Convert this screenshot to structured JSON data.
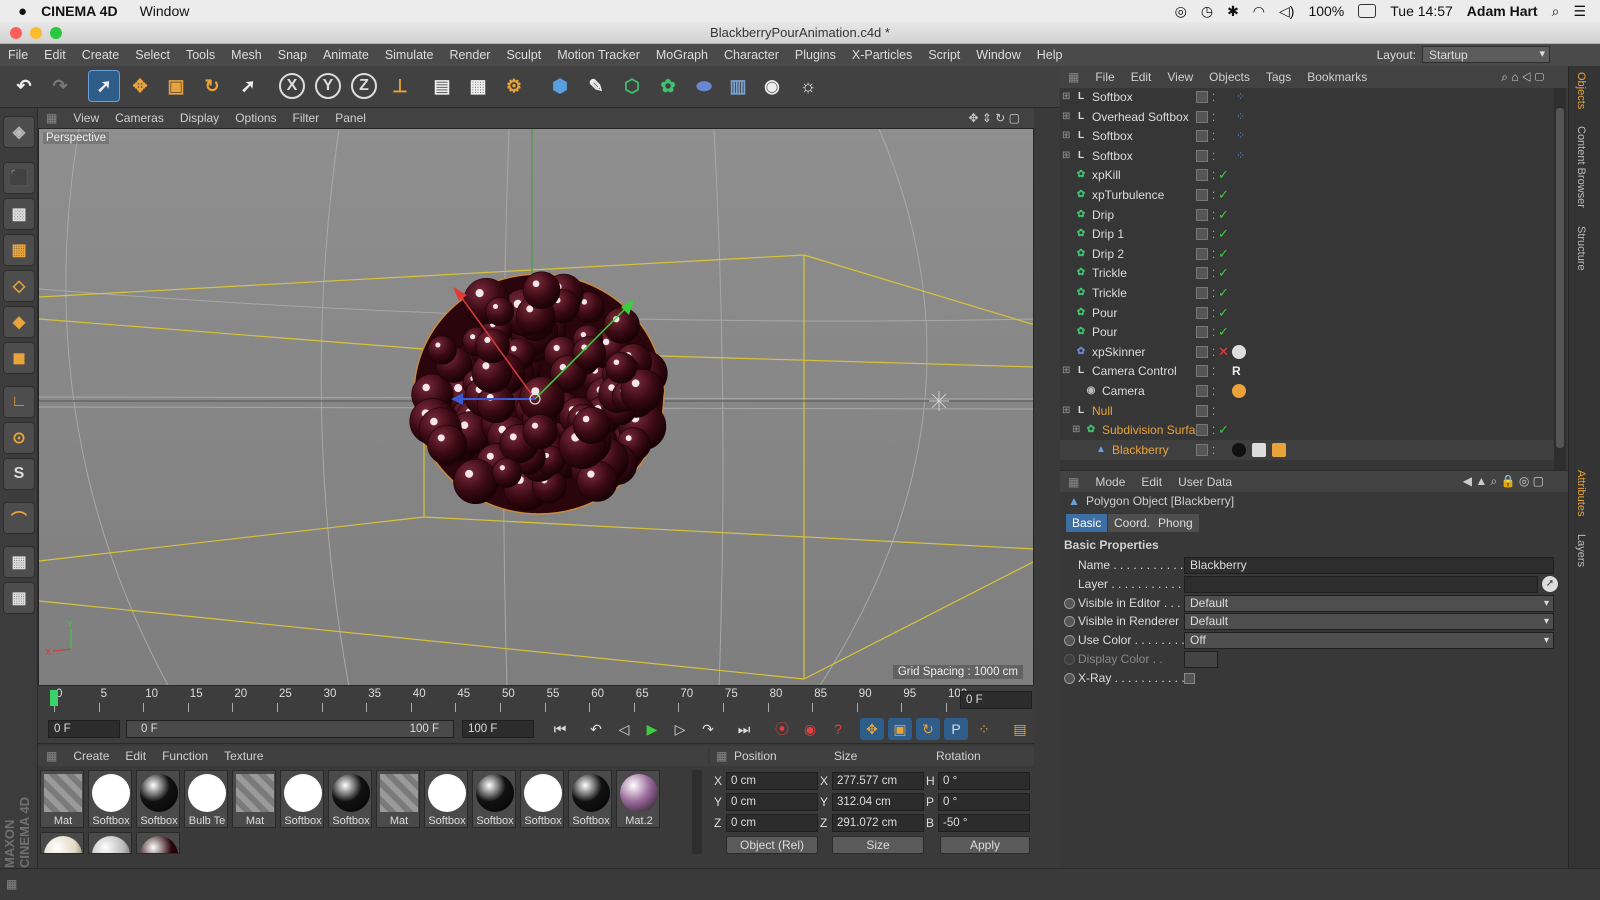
{
  "macbar": {
    "app_name": "CINEMA 4D",
    "menu": "Window",
    "battery": "100%",
    "clock": "Tue 14:57",
    "user": "Adam Hart"
  },
  "window": {
    "title": "BlackberryPourAnimation.c4d *"
  },
  "app_menu": [
    "File",
    "Edit",
    "Create",
    "Select",
    "Tools",
    "Mesh",
    "Snap",
    "Animate",
    "Simulate",
    "Render",
    "Sculpt",
    "Motion Tracker",
    "MoGraph",
    "Character",
    "Plugins",
    "X-Particles",
    "Script",
    "Window",
    "Help"
  ],
  "layout": {
    "label": "Layout:",
    "value": "Startup"
  },
  "toolbar": {
    "axes": [
      "X",
      "Y",
      "Z"
    ]
  },
  "viewport": {
    "menu": [
      "View",
      "Cameras",
      "Display",
      "Options",
      "Filter",
      "Panel"
    ],
    "label": "Perspective",
    "grid_spacing": "Grid Spacing : 1000 cm"
  },
  "timeline": {
    "ticks": [
      "0",
      "5",
      "10",
      "15",
      "20",
      "25",
      "30",
      "35",
      "40",
      "45",
      "50",
      "55",
      "60",
      "65",
      "70",
      "75",
      "80",
      "85",
      "90",
      "95",
      "100"
    ],
    "current_frame_field": "0 F",
    "start_field": "0 F",
    "range_start": "0 F",
    "range_end": "100 F",
    "end_field": "100 F"
  },
  "materials": {
    "menu": [
      "Create",
      "Edit",
      "Function",
      "Texture"
    ],
    "items": [
      {
        "label": "Mat",
        "color": "#8a8a8a"
      },
      {
        "label": "Softbox",
        "color": "#ffffff"
      },
      {
        "label": "Softbox",
        "color": "#111111"
      },
      {
        "label": "Bulb Te",
        "color": "#ffffff"
      },
      {
        "label": "Mat",
        "color": "#8a8a8a"
      },
      {
        "label": "Softbox",
        "color": "#ffffff"
      },
      {
        "label": "Softbox",
        "color": "#111111"
      },
      {
        "label": "Mat",
        "color": "#8a8a8a"
      },
      {
        "label": "Softbox",
        "color": "#ffffff"
      },
      {
        "label": "Softbox",
        "color": "#111111"
      },
      {
        "label": "Softbox",
        "color": "#ffffff"
      },
      {
        "label": "Softbox",
        "color": "#111111"
      },
      {
        "label": "Mat.2",
        "color": "#9a6a9a"
      }
    ]
  },
  "coords": {
    "headers": [
      "Position",
      "Size",
      "Rotation"
    ],
    "rows": [
      {
        "pl": "X",
        "pv": "0 cm",
        "sl": "X",
        "sv": "277.577 cm",
        "rl": "H",
        "rv": "0 °"
      },
      {
        "pl": "Y",
        "pv": "0 cm",
        "sl": "Y",
        "sv": "312.04 cm",
        "rl": "P",
        "rv": "0 °"
      },
      {
        "pl": "Z",
        "pv": "0 cm",
        "sl": "Z",
        "sv": "291.072 cm",
        "rl": "B",
        "rv": "-50 °"
      }
    ],
    "mode": "Object (Rel)",
    "size_mode": "Size",
    "apply": "Apply"
  },
  "objects": {
    "menu": [
      "File",
      "Edit",
      "View",
      "Objects",
      "Tags",
      "Bookmarks"
    ],
    "rows": [
      {
        "name": "Softbox",
        "indent": 0,
        "icon": "L0",
        "color": "#dcdcdc"
      },
      {
        "name": "Overhead Softbox",
        "indent": 0,
        "icon": "L0",
        "color": "#dcdcdc"
      },
      {
        "name": "Softbox",
        "indent": 0,
        "icon": "L0",
        "color": "#dcdcdc"
      },
      {
        "name": "Softbox",
        "indent": 0,
        "icon": "L0",
        "color": "#dcdcdc"
      },
      {
        "name": "xpKill",
        "indent": 0,
        "icon": "K",
        "color": "#dcdcdc"
      },
      {
        "name": "xpTurbulence",
        "indent": 0,
        "icon": "T",
        "color": "#dcdcdc"
      },
      {
        "name": "Drip",
        "indent": 0,
        "icon": "E",
        "color": "#dcdcdc"
      },
      {
        "name": "Drip 1",
        "indent": 0,
        "icon": "E",
        "color": "#dcdcdc"
      },
      {
        "name": "Drip 2",
        "indent": 0,
        "icon": "E",
        "color": "#dcdcdc"
      },
      {
        "name": "Trickle",
        "indent": 0,
        "icon": "E",
        "color": "#dcdcdc"
      },
      {
        "name": "Trickle",
        "indent": 0,
        "icon": "E",
        "color": "#dcdcdc"
      },
      {
        "name": "Pour",
        "indent": 0,
        "icon": "E",
        "color": "#dcdcdc"
      },
      {
        "name": "Pour",
        "indent": 0,
        "icon": "E",
        "color": "#dcdcdc"
      },
      {
        "name": "xpSkinner",
        "indent": 0,
        "icon": "S",
        "color": "#dcdcdc"
      },
      {
        "name": "Camera Control",
        "indent": 0,
        "icon": "L0",
        "color": "#dcdcdc"
      },
      {
        "name": "Camera",
        "indent": 1,
        "icon": "C",
        "color": "#dcdcdc"
      },
      {
        "name": "Null",
        "indent": 0,
        "icon": "L0",
        "color": "#e8a33a"
      },
      {
        "name": "Subdivision Surface",
        "indent": 1,
        "icon": "SD",
        "color": "#e8a33a"
      },
      {
        "name": "Blackberry",
        "indent": 2,
        "icon": "P",
        "color": "#e8a33a"
      }
    ]
  },
  "attributes": {
    "menu": [
      "Mode",
      "Edit",
      "User Data"
    ],
    "object_title": "Polygon Object [Blackberry]",
    "tabs": [
      "Basic",
      "Coord.",
      "Phong"
    ],
    "section": "Basic Properties",
    "fields": [
      {
        "label": "Name . . . . . . . . . . . .",
        "value": "Blackberry",
        "type": "text"
      },
      {
        "label": "Layer . . . . . . . . . . . .",
        "value": "",
        "type": "text"
      },
      {
        "label": "Visible in Editor . . .",
        "value": "Default",
        "type": "dd"
      },
      {
        "label": "Visible in Renderer",
        "value": "Default",
        "type": "dd"
      },
      {
        "label": "Use Color . . . . . . . .",
        "value": "Off",
        "type": "dd"
      },
      {
        "label": "Display Color . .",
        "value": "",
        "type": "swatch"
      },
      {
        "label": "X-Ray . . . . . . . . . . .",
        "value": "",
        "type": "check"
      }
    ]
  },
  "right_tabs": [
    "Objects",
    "Content Browser",
    "Structure",
    "Attributes",
    "Layers"
  ],
  "branding": "MAXON CINEMA 4D"
}
